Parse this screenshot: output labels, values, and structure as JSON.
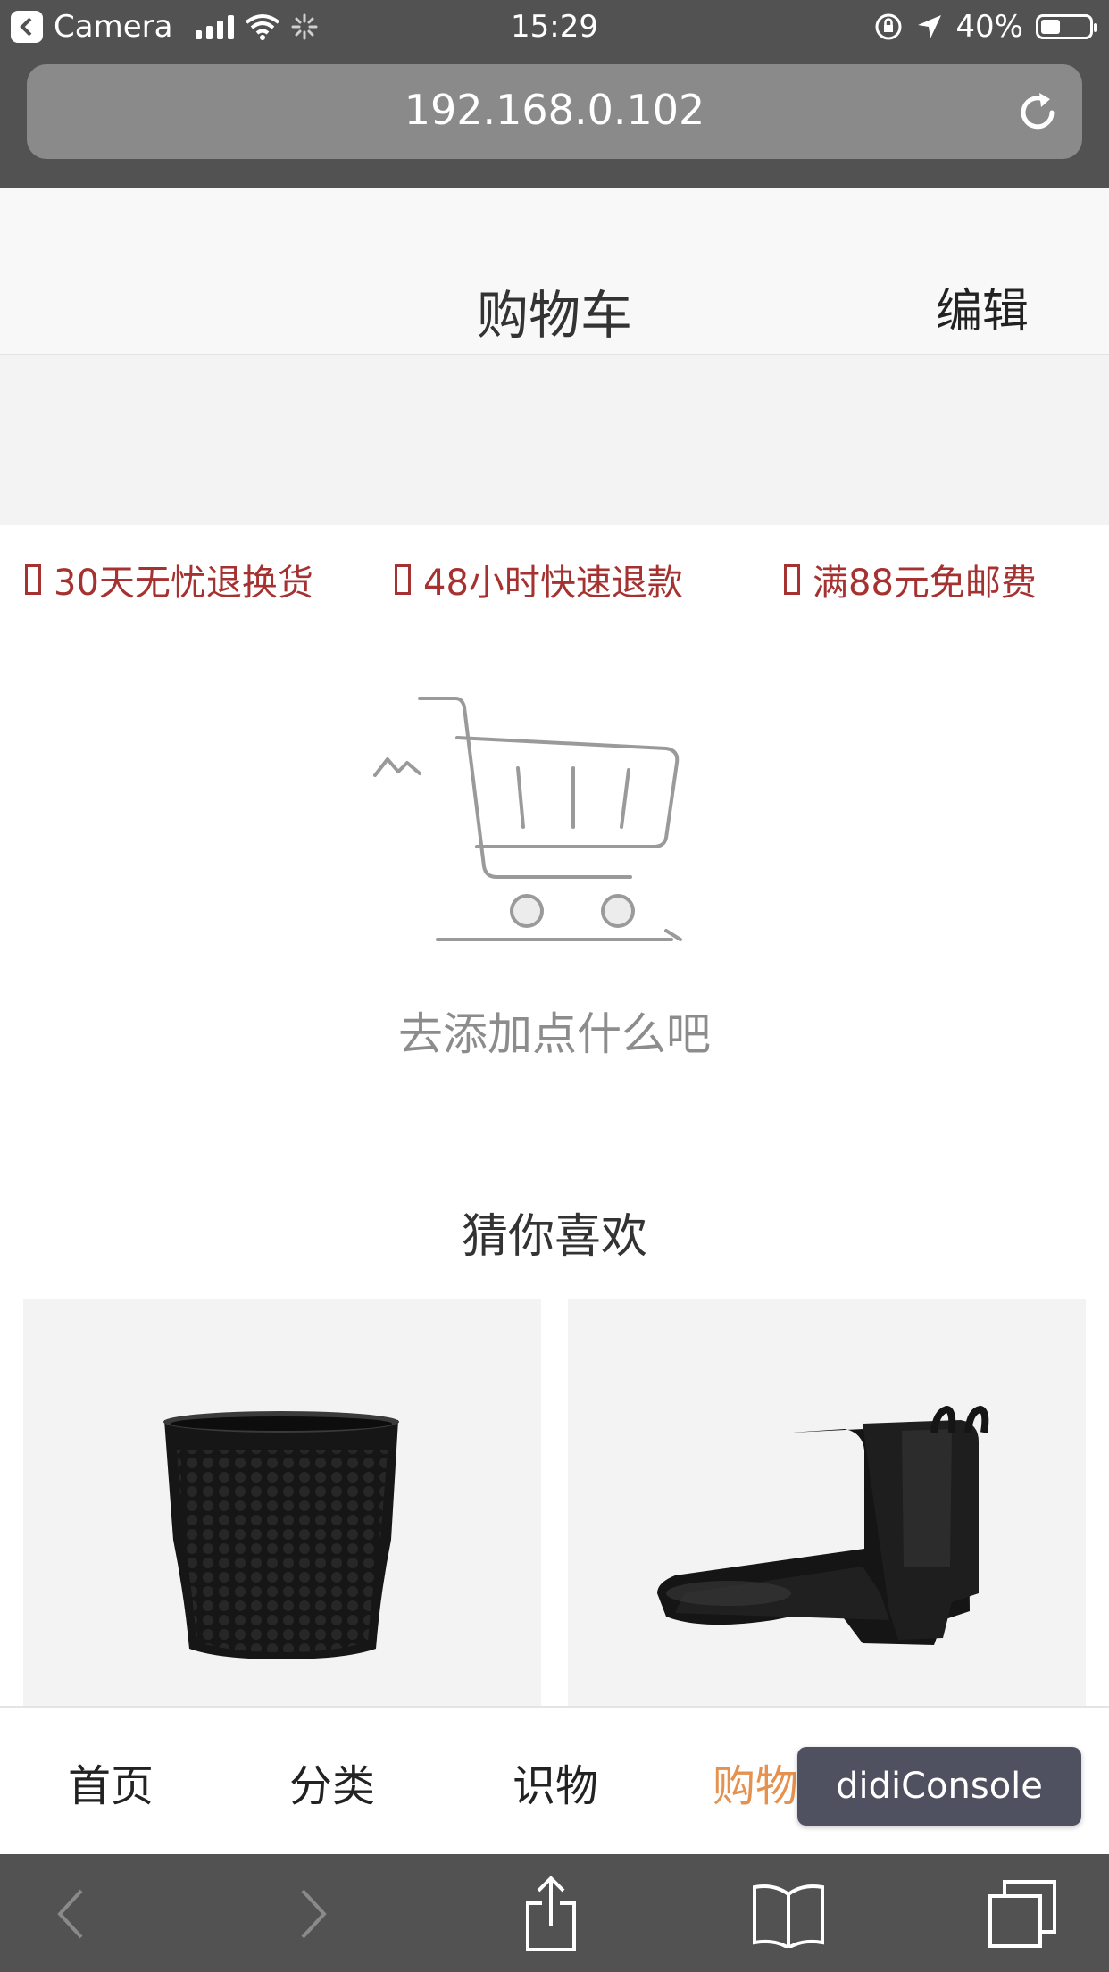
{
  "status_bar": {
    "back_app": "Camera",
    "time": "15:29",
    "battery": "40%",
    "battery_level": 0.4
  },
  "browser": {
    "url": "192.168.0.102"
  },
  "header": {
    "title": "购物车",
    "edit_label": "编辑"
  },
  "services": [
    {
      "label": "30天无忧退换货"
    },
    {
      "label": "48小时快速退款"
    },
    {
      "label": "满88元免邮费"
    }
  ],
  "empty_state": {
    "message": "去添加点什么吧"
  },
  "recommend": {
    "title": "猜你喜欢"
  },
  "tabs": [
    {
      "label": "首页",
      "active": false
    },
    {
      "label": "分类",
      "active": false
    },
    {
      "label": "识物",
      "active": false
    },
    {
      "label": "购物",
      "active": true
    }
  ],
  "console": {
    "label": "didiConsole"
  },
  "colors": {
    "accent": "#e5914f",
    "service_red": "#a53230",
    "console_bg": "#4f5161"
  }
}
